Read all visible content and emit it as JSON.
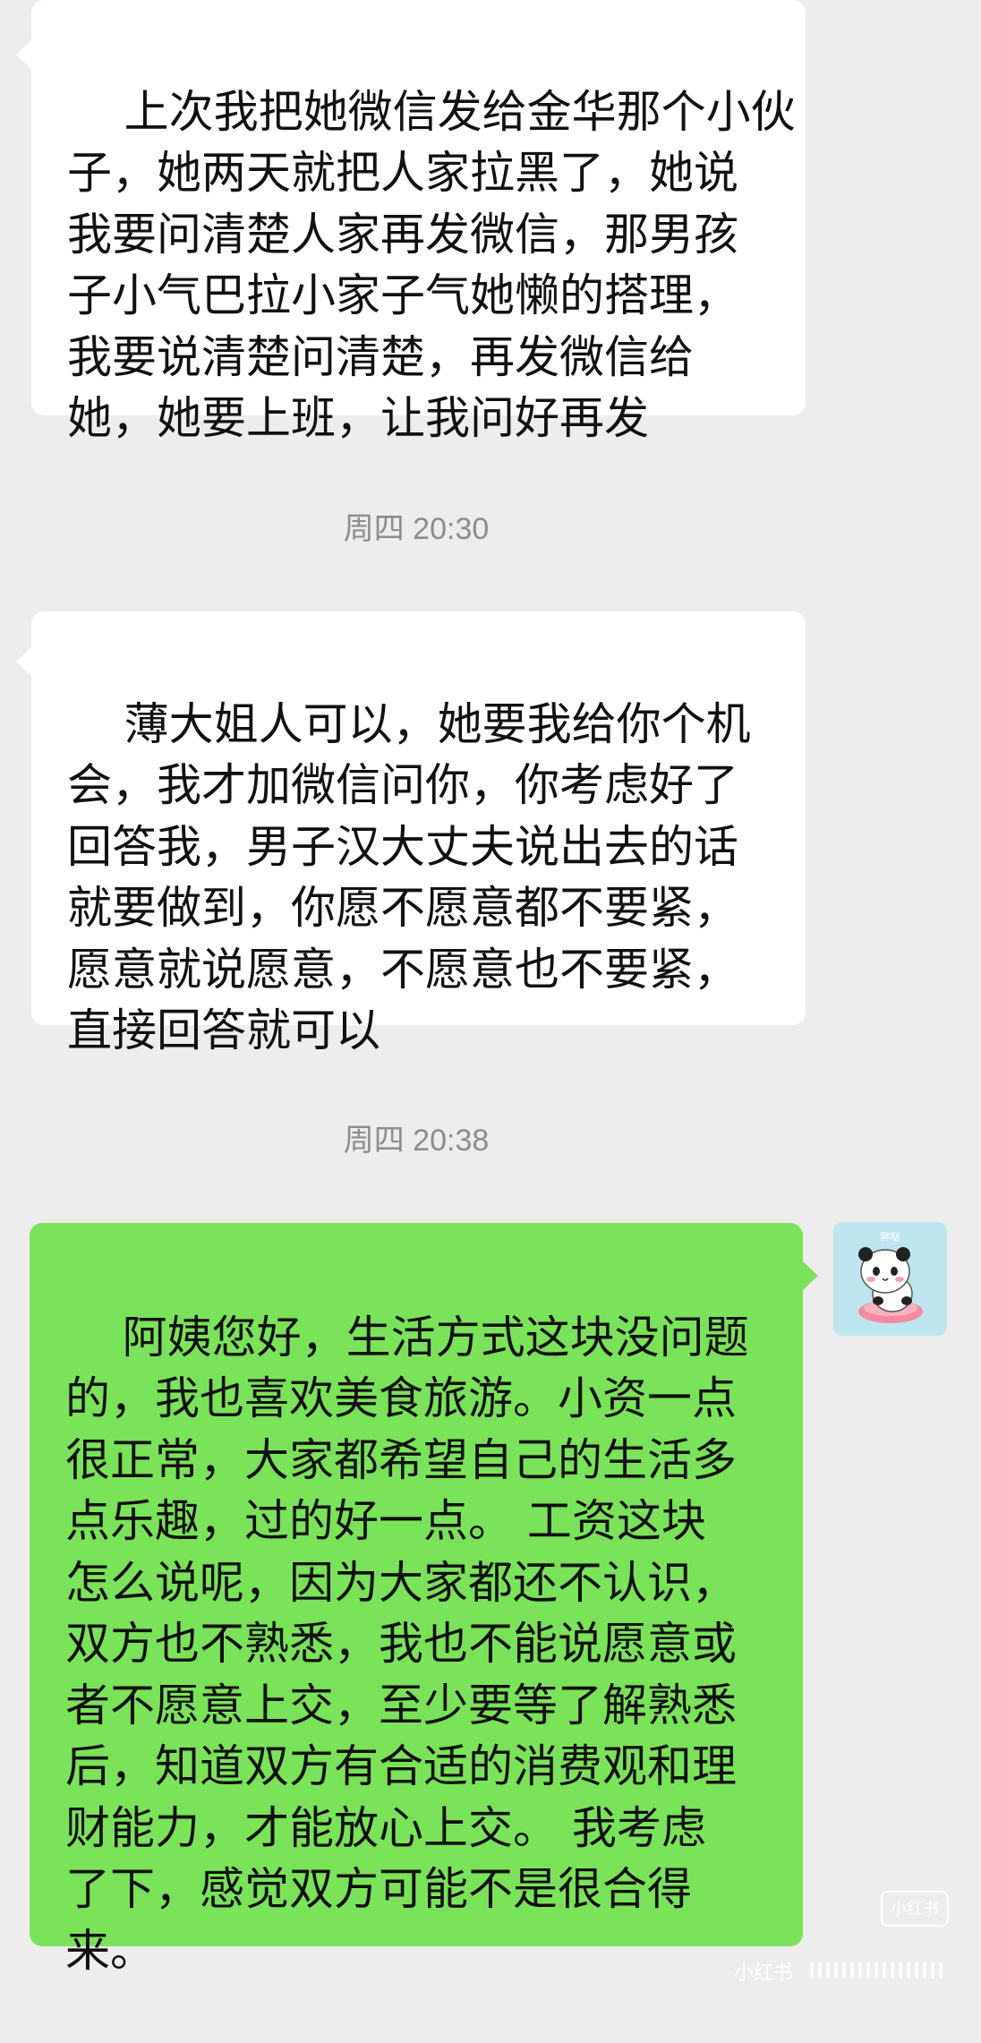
{
  "messages": [
    {
      "side": "incoming",
      "text": "上次我把她微信发给金华那个小伙\n子，她两天就把人家拉黑了，她说\n我要问清楚人家再发微信，那男孩\n子小气巴拉小家子气她懒的搭理，\n我要说清楚问清楚，再发微信给\n她，她要上班，让我问好再发"
    },
    {
      "side": "incoming",
      "text": "薄大姐人可以，她要我给你个机\n会，我才加微信问你，你考虑好了\n回答我，男子汉大丈夫说出去的话\n就要做到，你愿不愿意都不要紧，\n愿意就说愿意，不愿意也不要紧，\n直接回答就可以"
    },
    {
      "side": "outgoing",
      "text": "阿姨您好，生活方式这块没问题\n的，我也喜欢美食旅游。小资一点\n很正常，大家都希望自己的生活多\n点乐趣，过的好一点。 工资这块\n怎么说呢，因为大家都还不认识，\n双方也不熟悉，我也不能说愿意或\n者不愿意上交，至少要等了解熟悉\n后，知道双方有合适的消费观和理\n财能力，才能放心上交。 我考虑\n了下，感觉双方可能不是很合得\n来。"
    }
  ],
  "timestamps": [
    "周四 20:30",
    "周四 20:38"
  ],
  "avatar": {
    "icon": "panda-sticker-avatar",
    "caption": "胖哒"
  },
  "watermark": {
    "badge": "小红书",
    "text": "小红书"
  },
  "colors": {
    "background": "#ededed",
    "incoming_bubble": "#ffffff",
    "outgoing_bubble": "#7be35a",
    "timestamp_text": "#8c8c8c"
  }
}
